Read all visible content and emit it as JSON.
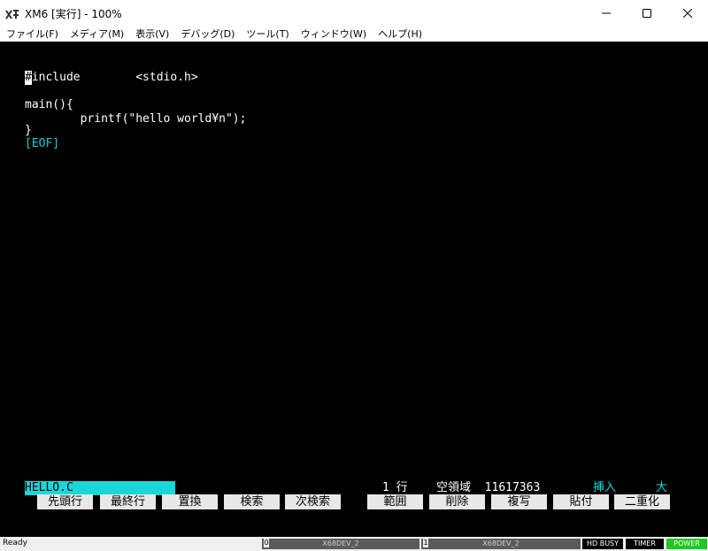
{
  "window": {
    "title": "XM6 [実行] - 100%"
  },
  "menu": [
    {
      "label": "ファイル(F)"
    },
    {
      "label": "メディア(M)"
    },
    {
      "label": "表示(V)"
    },
    {
      "label": "デバッグ(D)"
    },
    {
      "label": "ツール(T)"
    },
    {
      "label": "ウィンドウ(W)"
    },
    {
      "label": "ヘルプ(H)"
    }
  ],
  "editor": {
    "cursor_char": "#",
    "line1_rest": "include        <stdio.h>",
    "line2": "main(){",
    "line3": "        printf(\"hello world¥n\");",
    "line4": "}",
    "eof": "[EOF]"
  },
  "status": {
    "filename": "HELLO.C",
    "line": "1 行",
    "free_label": "空領域",
    "free_value": "11617363",
    "mode": "挿入",
    "size": "大"
  },
  "function_keys": [
    {
      "label": "先頭行"
    },
    {
      "label": "最終行"
    },
    {
      "label": "置換"
    },
    {
      "label": "検索"
    },
    {
      "label": "次検索"
    },
    {
      "label": "範囲"
    },
    {
      "label": "削除"
    },
    {
      "label": "複写"
    },
    {
      "label": "貼付"
    },
    {
      "label": "二重化"
    }
  ],
  "statusbar": {
    "ready": "Ready",
    "drive0_num": "0",
    "drive0_label": "X68DEV_2",
    "drive1_num": "1",
    "drive1_label": "X68DEV_2",
    "hd_busy": "HD BUSY",
    "timer": "TIMER",
    "power": "POWER"
  },
  "colors": {
    "screen_bg": "#000000",
    "cyan": "#19d7d9",
    "power": "#21c821"
  }
}
